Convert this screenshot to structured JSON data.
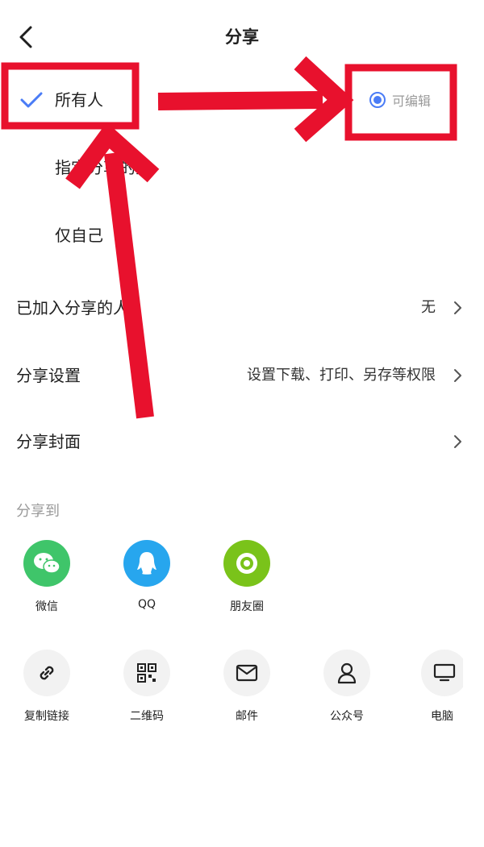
{
  "header": {
    "title": "分享",
    "back_icon": "chevron-left-icon"
  },
  "visibility_options": [
    {
      "label": "所有人",
      "selected": true
    },
    {
      "label": "指定分享的人",
      "selected": false
    },
    {
      "label": "仅自己",
      "selected": false
    }
  ],
  "permission": {
    "label": "可编辑",
    "selected": true
  },
  "settings": [
    {
      "label": "已加入分享的人",
      "value": "无"
    },
    {
      "label": "分享设置",
      "value": "设置下载、打印、另存等权限"
    },
    {
      "label": "分享封面",
      "value": ""
    }
  ],
  "share_to": {
    "title": "分享到",
    "apps": [
      {
        "label": "微信",
        "icon": "wechat-icon",
        "color": "#3fc56a"
      },
      {
        "label": "QQ",
        "icon": "qq-icon",
        "color": "#27a6ee"
      },
      {
        "label": "朋友圈",
        "icon": "moments-icon",
        "color": "#7ac31a"
      }
    ],
    "tools": [
      {
        "label": "复制链接",
        "icon": "link-icon"
      },
      {
        "label": "二维码",
        "icon": "qrcode-icon"
      },
      {
        "label": "邮件",
        "icon": "mail-icon"
      },
      {
        "label": "公众号",
        "icon": "official-account-icon"
      },
      {
        "label": "电脑",
        "icon": "computer-icon"
      }
    ]
  },
  "colors": {
    "accent": "#4a7cf6",
    "annotation": "#e8112d"
  }
}
